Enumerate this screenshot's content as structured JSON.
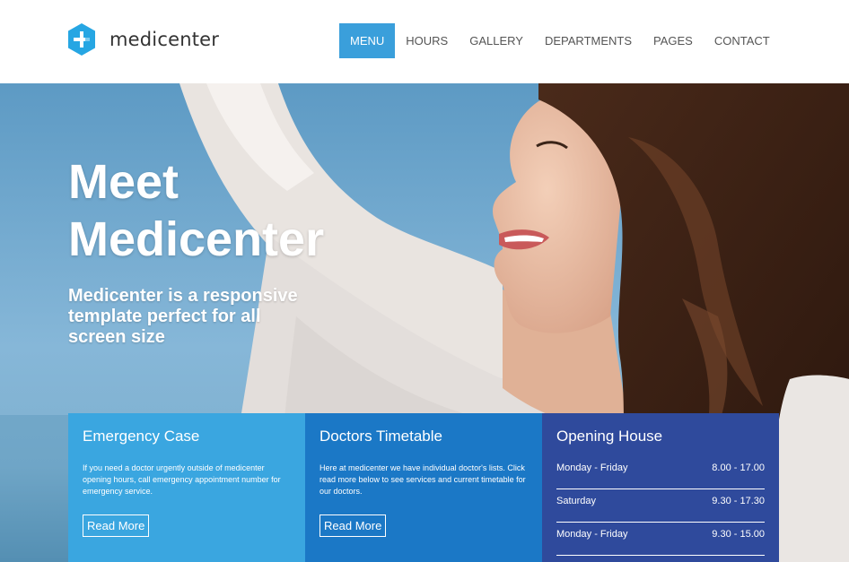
{
  "brand": {
    "name": "medicenter",
    "accent": "#3a9fdb"
  },
  "nav": {
    "items": [
      {
        "label": "MENU",
        "active": true
      },
      {
        "label": "HOURS",
        "active": false
      },
      {
        "label": "GALLERY",
        "active": false
      },
      {
        "label": "DEPARTMENTS",
        "active": false
      },
      {
        "label": "PAGES",
        "active": false
      },
      {
        "label": "CONTACT",
        "active": false
      }
    ]
  },
  "hero": {
    "title": "Meet Medicenter",
    "subtitle": "Medicenter is a responsive template perfect for all screen size"
  },
  "boxes": {
    "emergency": {
      "title": "Emergency Case",
      "text": "If you need a doctor urgently outside of medicenter opening hours, call emergency appointment number for emergency service.",
      "button": "Read More",
      "color": "#3aa6e0"
    },
    "timetable": {
      "title": "Doctors Timetable",
      "text": "Here at medicenter we have individual doctor's lists. Click read more below to see services and current timetable for our doctors.",
      "button": "Read More",
      "color": "#1b78c6"
    },
    "opening": {
      "title": "Opening House",
      "color": "#2f4a9c",
      "rows": [
        {
          "day": "Monday - Friday",
          "time": "8.00 - 17.00"
        },
        {
          "day": "Saturday",
          "time": "9.30 - 17.30"
        },
        {
          "day": "Monday - Friday",
          "time": "9.30 - 15.00"
        }
      ]
    }
  }
}
